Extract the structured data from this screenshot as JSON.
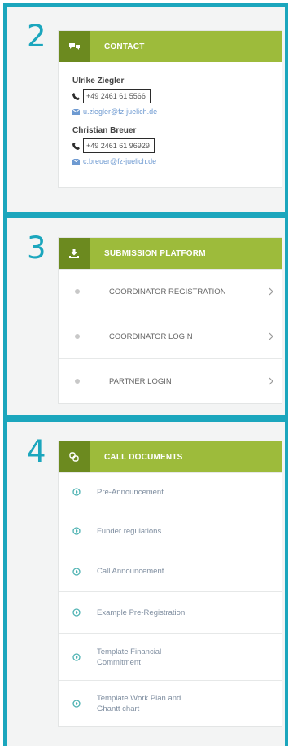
{
  "panels": {
    "contact": {
      "number": "2",
      "title": "CONTACT",
      "people": [
        {
          "name": "Ulrike Ziegler",
          "phone": "+49 2461 61 5566",
          "email": "u.ziegler@fz-juelich.de"
        },
        {
          "name": "Christian Breuer",
          "phone": "+49 2461 61 96929",
          "email": "c.breuer@fz-juelich.de"
        }
      ]
    },
    "submission": {
      "number": "3",
      "title": "SUBMISSION PLATFORM",
      "items": [
        {
          "label": "COORDINATOR REGISTRATION"
        },
        {
          "label": "COORDINATOR LOGIN"
        },
        {
          "label": "PARTNER LOGIN"
        }
      ]
    },
    "documents": {
      "number": "4",
      "title": "CALL DOCUMENTS",
      "items": [
        {
          "label": "Pre-Announcement"
        },
        {
          "label": "Funder regulations"
        },
        {
          "label": "Call Announcement"
        },
        {
          "label": "Example Pre-Registration"
        },
        {
          "label": "Template Financial Commitment"
        },
        {
          "label": "Template Work Plan and Ghantt chart"
        }
      ]
    }
  },
  "colors": {
    "frame": "#1ba6bd",
    "header": "#9dbb3b",
    "header_icon": "#6c8a1f",
    "email": "#6e9ad1"
  },
  "icons": {
    "contact": "chat-bubbles-icon",
    "submission": "download-icon",
    "documents": "link-icon",
    "phone": "phone-icon",
    "email": "envelope-icon",
    "row": "bullet-dot-icon",
    "chevron": "chevron-right-icon",
    "document": "circle-play-icon"
  }
}
